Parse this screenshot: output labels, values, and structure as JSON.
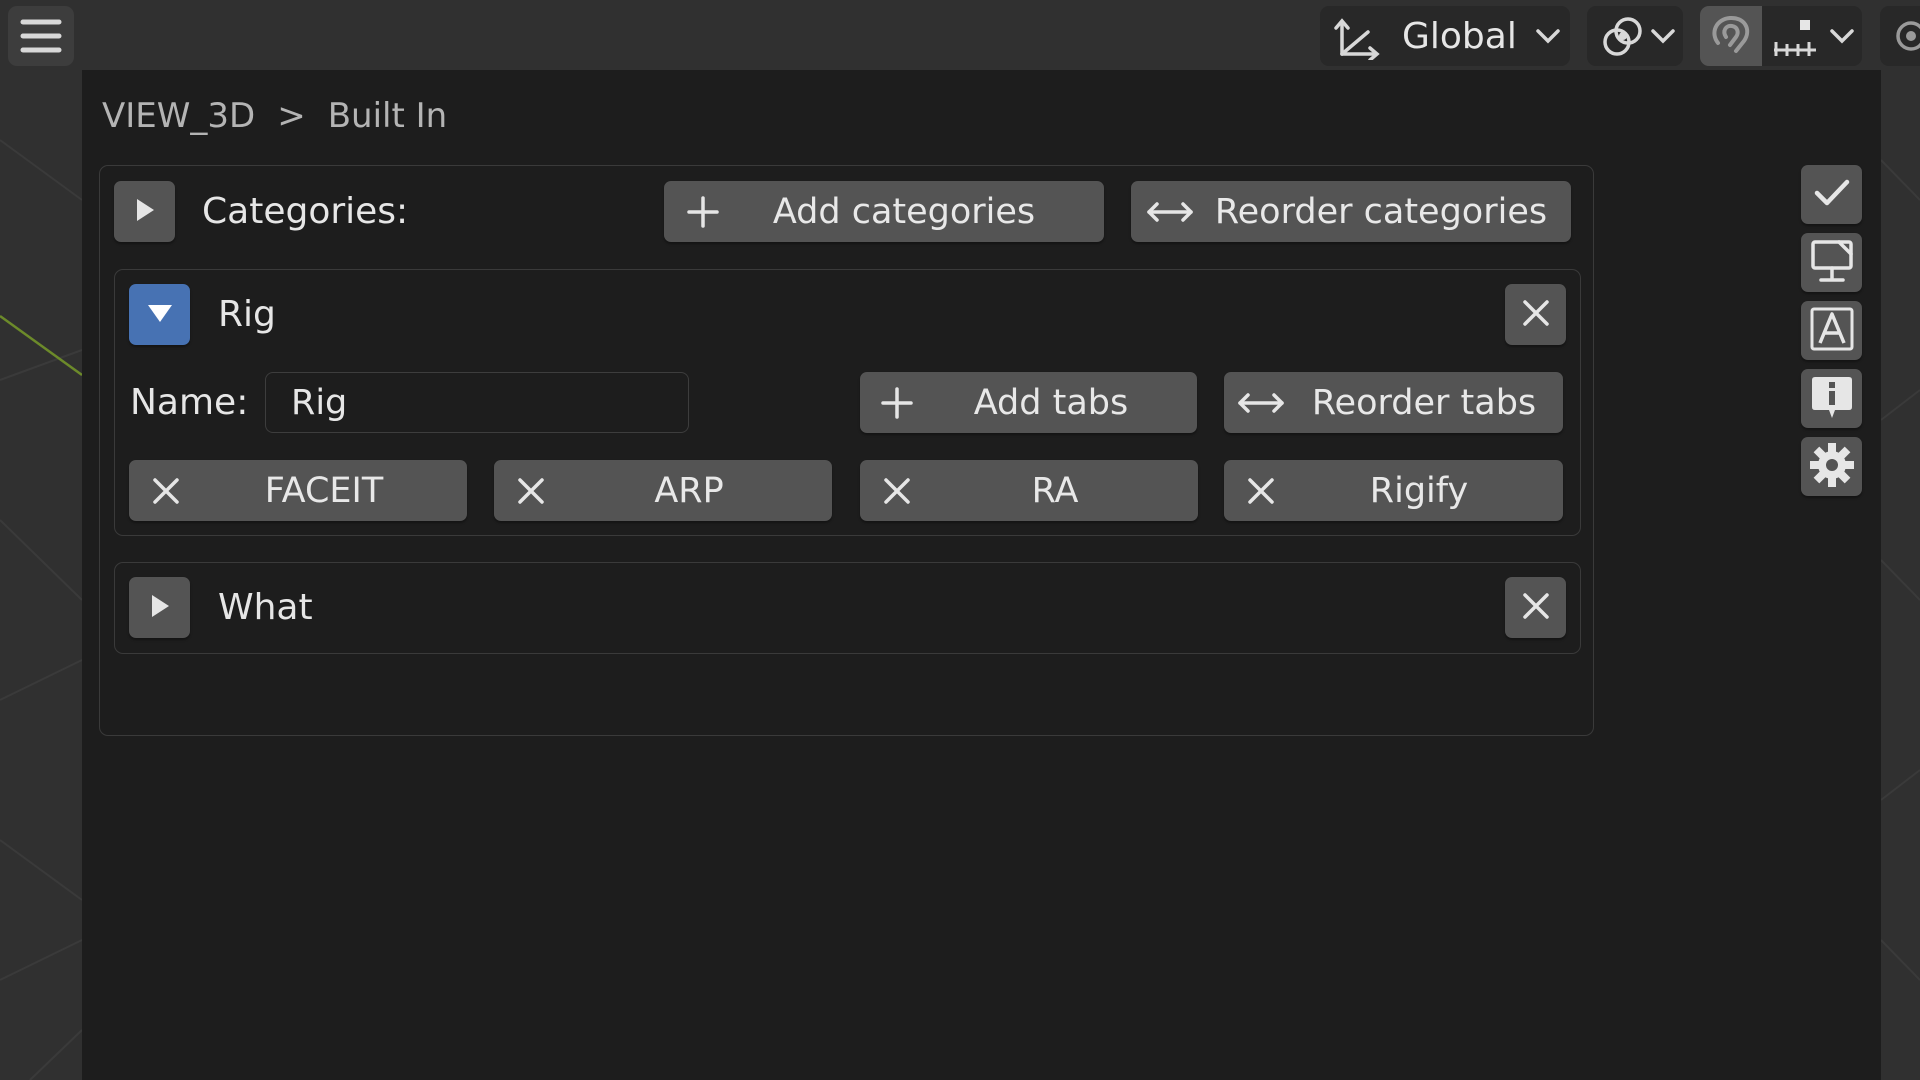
{
  "header": {
    "orientation_value": "Global",
    "menu_icon": "hamburger-menu-icon",
    "orientation_icon": "transform-orientation-icon",
    "pivot_icon": "pivot-point-icon",
    "snap_icon": "snap-magnet-icon",
    "snap_target_icon": "snap-increment-icon",
    "proportional_icon": "proportional-editing-icon"
  },
  "breadcrumb": {
    "root": "VIEW_3D",
    "separator": ">",
    "current": "Built In"
  },
  "categories": {
    "label": "Categories:",
    "add_label": "Add categories",
    "reorder_label": "Reorder categories",
    "items": [
      {
        "title": "Rig",
        "expanded": true,
        "name_label": "Name:",
        "name_value": "Rig",
        "add_tabs_label": "Add tabs",
        "reorder_tabs_label": "Reorder tabs",
        "tabs": [
          "FACEIT",
          "ARP",
          "RA",
          "Rigify"
        ]
      },
      {
        "title": "What",
        "expanded": false
      }
    ]
  },
  "sidebar": {
    "icons": [
      "checkmark-icon",
      "monitor-display-icon",
      "text-font-icon",
      "info-icon",
      "settings-gear-icon"
    ]
  },
  "colors": {
    "active_blue": "#4772b3",
    "panel_bg": "#1d1d1d",
    "button_bg": "#545454",
    "viewport_bg": "#303030"
  }
}
